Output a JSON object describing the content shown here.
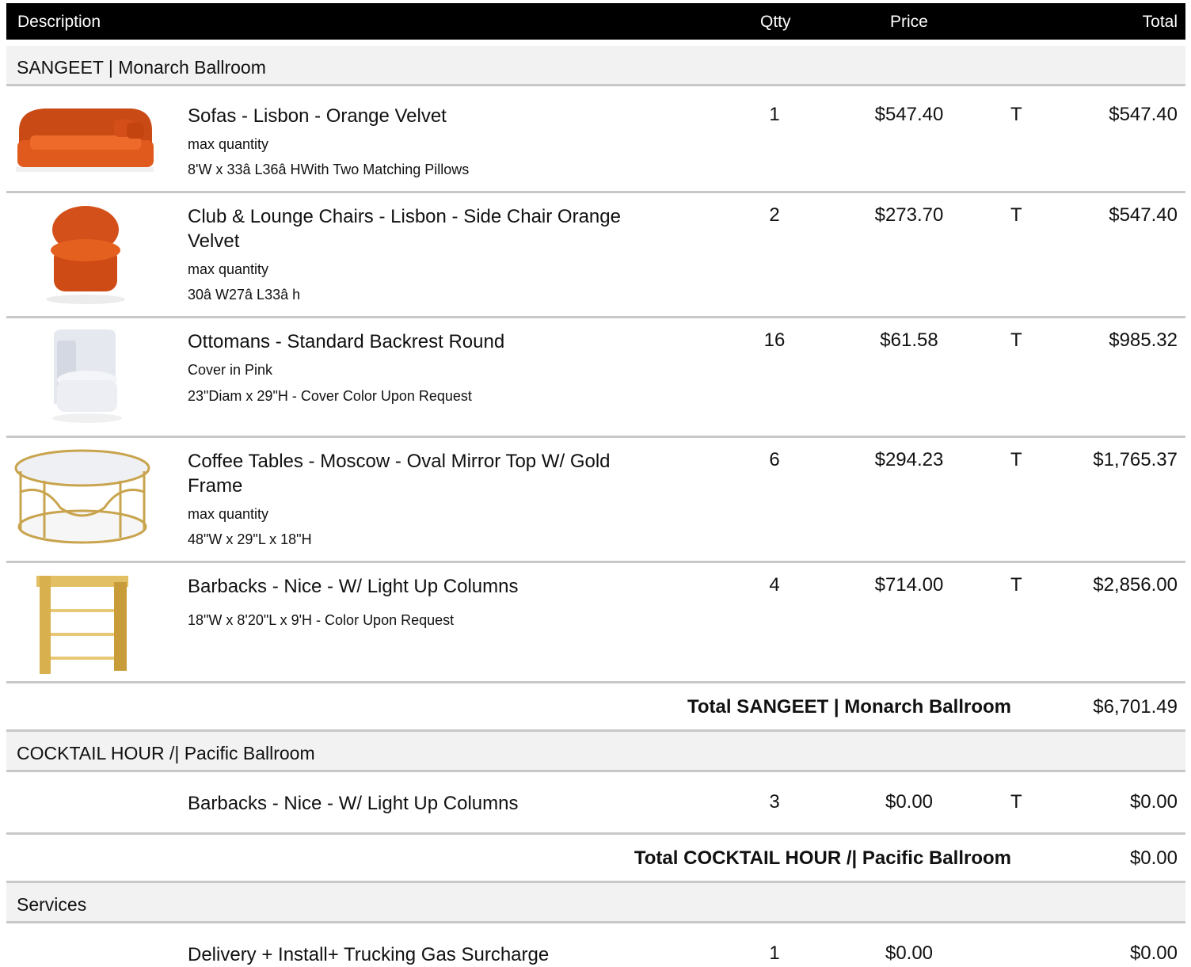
{
  "header": {
    "description": "Description",
    "qtty": "Qtty",
    "price": "Price",
    "total": "Total"
  },
  "sections": [
    {
      "title": "SANGEET | Monarch Ballroom",
      "items": [
        {
          "name": "Sofas - Lisbon - Orange Velvet",
          "note": "max quantity",
          "details": "8'W x 33â   L36â   HWith Two Matching Pillows",
          "qty": "1",
          "price": "$547.40",
          "tax": "T",
          "total": "$547.40",
          "image": "orange-velvet-sofa"
        },
        {
          "name": "Club & Lounge Chairs - Lisbon - Side Chair Orange Velvet",
          "note": "max quantity",
          "details": "30â   W27â   L33â   h",
          "qty": "2",
          "price": "$273.70",
          "tax": "T",
          "total": "$547.40",
          "image": "orange-side-chair"
        },
        {
          "name": "Ottomans - Standard Backrest Round",
          "note": "Cover in Pink",
          "details": "23\"Diam x 29\"H - Cover Color Upon Request",
          "qty": "16",
          "price": "$61.58",
          "tax": "T",
          "total": "$985.32",
          "image": "white-round-ottoman"
        },
        {
          "name": "Coffee Tables - Moscow - Oval Mirror Top W/ Gold Frame",
          "note": "max quantity",
          "details": "48\"W x 29\"L x 18\"H",
          "qty": "6",
          "price": "$294.23",
          "tax": "T",
          "total": "$1,765.37",
          "image": "gold-oval-coffee-table"
        },
        {
          "name": "Barbacks - Nice - W/ Light Up Columns",
          "note": "",
          "details": "18\"W x 8'20\"L x 9'H - Color Upon Request",
          "qty": "4",
          "price": "$714.00",
          "tax": "T",
          "total": "$2,856.00",
          "image": "gold-barback"
        }
      ],
      "subtotal_label": "Total  SANGEET | Monarch Ballroom",
      "subtotal": "$6,701.49"
    },
    {
      "title": "COCKTAIL HOUR /| Pacific Ballroom",
      "items": [
        {
          "name": "Barbacks - Nice - W/ Light Up Columns",
          "qty": "3",
          "price": "$0.00",
          "tax": "T",
          "total": "$0.00"
        }
      ],
      "subtotal_label": "Total  COCKTAIL HOUR /| Pacific Ballroom",
      "subtotal": "$0.00"
    },
    {
      "title": "Services",
      "items": [
        {
          "name": "Delivery + Install+ Trucking Gas Surcharge",
          "qty": "1",
          "price": "$0.00",
          "total": "$0.00"
        }
      ]
    }
  ],
  "colors": {
    "header_bg": "#000000",
    "section_bg": "#f2f2f2",
    "divider": "#c8c8c8",
    "orange": "#d9541e",
    "gold": "#d4b05a"
  }
}
